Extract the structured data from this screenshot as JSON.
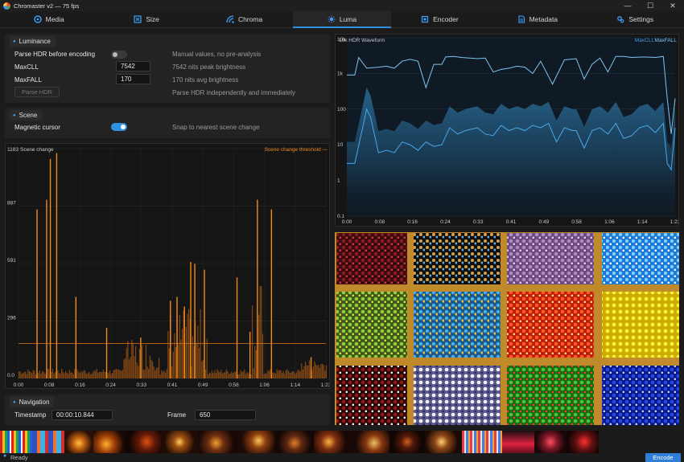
{
  "window": {
    "title": "Chromaster v2 — 75 fps",
    "minimize": "—",
    "maximize": "☐",
    "close": "✕"
  },
  "tabs": [
    {
      "label": "Media",
      "icon": "media-icon"
    },
    {
      "label": "Size",
      "icon": "size-icon"
    },
    {
      "label": "Chroma",
      "icon": "chroma-icon"
    },
    {
      "label": "Luma",
      "icon": "luma-icon",
      "active": true
    },
    {
      "label": "Encoder",
      "icon": "encoder-icon"
    },
    {
      "label": "Metadata",
      "icon": "metadata-icon"
    },
    {
      "label": "Settings",
      "icon": "gear-icon"
    }
  ],
  "luminance": {
    "heading": "Luminance",
    "parse_label": "Parse HDR before encoding",
    "parse_toggle": false,
    "parse_hint": "Manual values, no pre-analysis",
    "maxcll_label": "MaxCLL",
    "maxcll_value": "7542",
    "maxcll_hint": "7542 nits peak brightness",
    "maxfall_label": "MaxFALL",
    "maxfall_value": "170",
    "maxfall_hint": "170 nits avg brightness",
    "parse_button": "Parse HDR",
    "parse_button_hint": "Parse HDR independently and immediately"
  },
  "scene": {
    "heading": "Scene",
    "magnetic_label": "Magnetic cursor",
    "magnetic_toggle": true,
    "magnetic_hint": "Snap to nearest scene change"
  },
  "navigation": {
    "heading": "Navigation",
    "timestamp_label": "Timestamp",
    "timestamp_value": "00:00:10.844",
    "frame_label": "Frame",
    "frame_value": "650"
  },
  "status": {
    "text": "Ready",
    "encode_button": "Encode"
  },
  "colors": {
    "accent": "#2f8fe0",
    "scene_bars": "#f08a1c",
    "waveform": "#3a9ad9"
  },
  "chart_data": [
    {
      "type": "bar",
      "title": "Scene change",
      "legend": "Scene change threshold",
      "threshold": 180,
      "ylim": [
        0,
        1183
      ],
      "yticks": [
        "1183",
        "887",
        "591",
        "296",
        "0.0"
      ],
      "xticks": [
        "0:00",
        "0:08",
        "0:16",
        "0:24",
        "0:33",
        "0:41",
        "0:49",
        "0:58",
        "1:06",
        "1:14",
        "1:23"
      ],
      "x_range": [
        0,
        83
      ],
      "spikes": [
        {
          "x": 5.0,
          "y": 870
        },
        {
          "x": 7.6,
          "y": 920
        },
        {
          "x": 8.6,
          "y": 1130
        },
        {
          "x": 10.3,
          "y": 1160
        },
        {
          "x": 15.5,
          "y": 420
        },
        {
          "x": 23.8,
          "y": 260
        },
        {
          "x": 33.0,
          "y": 210
        },
        {
          "x": 41.0,
          "y": 400
        },
        {
          "x": 42.8,
          "y": 420
        },
        {
          "x": 44.8,
          "y": 370
        },
        {
          "x": 46.5,
          "y": 600
        },
        {
          "x": 47.6,
          "y": 590
        },
        {
          "x": 50.2,
          "y": 560
        },
        {
          "x": 59.0,
          "y": 520
        },
        {
          "x": 62.5,
          "y": 240
        },
        {
          "x": 64.5,
          "y": 920
        },
        {
          "x": 68.3,
          "y": 870
        },
        {
          "x": 79.0,
          "y": 110
        }
      ]
    },
    {
      "type": "line",
      "title": "HDR Waveform",
      "yscale": "log",
      "ylim": [
        0.1,
        10000
      ],
      "yticks": [
        "10k",
        "1k",
        "100",
        "10",
        "1",
        "0.1"
      ],
      "xticks": [
        "0:00",
        "0:08",
        "0:16",
        "0:24",
        "0:33",
        "0:41",
        "0:49",
        "0:58",
        "1:06",
        "1:14",
        "1:23"
      ],
      "x_range": [
        0,
        83
      ],
      "legend": [
        "MaxCLL",
        "MaxFALL"
      ],
      "series": [
        {
          "name": "MaxCLL",
          "x": [
            0,
            2,
            3,
            5,
            8,
            10,
            12,
            14,
            16,
            18,
            20,
            22,
            24,
            25,
            27,
            29,
            31,
            33,
            35,
            37,
            39,
            41,
            43,
            45,
            47,
            49,
            52,
            55,
            58,
            60,
            62,
            64,
            66,
            68,
            70,
            72,
            75,
            78,
            80,
            81,
            82,
            83
          ],
          "y": [
            900,
            900,
            2800,
            1400,
            1500,
            1600,
            1400,
            2200,
            2500,
            2200,
            400,
            1800,
            1800,
            2900,
            3000,
            2800,
            2700,
            2600,
            2700,
            1100,
            1300,
            1400,
            1600,
            1500,
            1000,
            2200,
            500,
            2400,
            2600,
            700,
            1800,
            2700,
            1100,
            3000,
            3000,
            2800,
            2900,
            2800,
            3000,
            200,
            20,
            200
          ]
        },
        {
          "name": "MaxFALL",
          "x": [
            0,
            2,
            4,
            5,
            6,
            8,
            10,
            12,
            14,
            16,
            18,
            20,
            22,
            24,
            26,
            28,
            30,
            33,
            35,
            37,
            39,
            41,
            43,
            45,
            47,
            49,
            51,
            53,
            55,
            57,
            58,
            60,
            62,
            64,
            66,
            68,
            70,
            72,
            74,
            76,
            78,
            80,
            81,
            82,
            83
          ],
          "y": [
            3,
            3,
            30,
            100,
            60,
            6,
            7,
            6,
            12,
            10,
            7,
            12,
            9,
            10,
            30,
            20,
            25,
            30,
            20,
            18,
            35,
            25,
            30,
            25,
            35,
            30,
            40,
            12,
            30,
            25,
            25,
            8,
            25,
            30,
            20,
            40,
            15,
            18,
            30,
            35,
            22,
            40,
            3,
            2,
            30
          ]
        }
      ]
    }
  ]
}
